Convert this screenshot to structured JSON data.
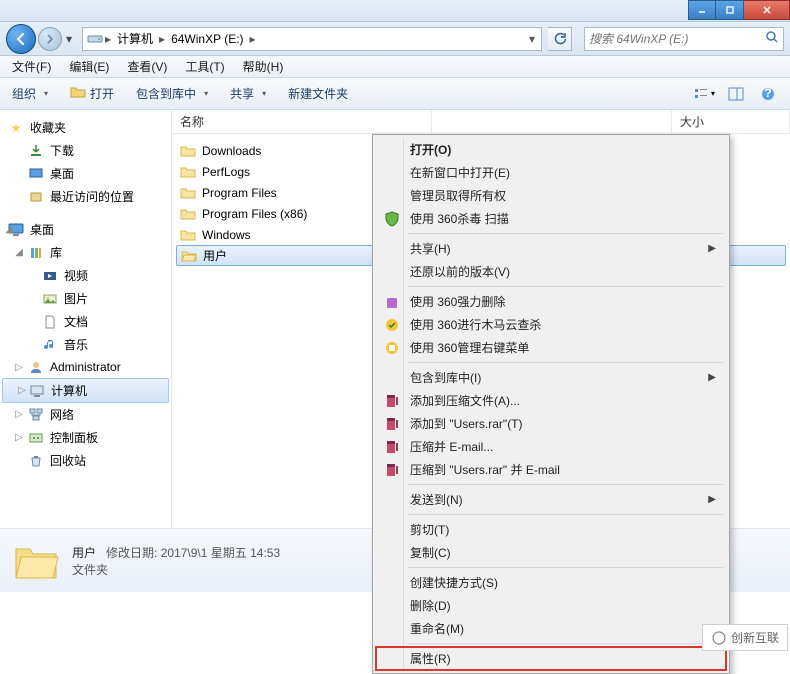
{
  "window": {
    "title_blank": ""
  },
  "address": {
    "root_icon": "computer-icon",
    "segs": [
      "计算机",
      "64WinXP (E:)"
    ],
    "refresh_icon": "refresh-icon"
  },
  "search": {
    "placeholder": "搜索 64WinXP (E:)"
  },
  "menubar": [
    "文件(F)",
    "编辑(E)",
    "查看(V)",
    "工具(T)",
    "帮助(H)"
  ],
  "toolbar": {
    "organize": "组织",
    "open": "打开",
    "include": "包含到库中",
    "share": "共享",
    "newfolder": "新建文件夹"
  },
  "columns": {
    "name": "名称",
    "size": "大小"
  },
  "sidebar": {
    "favorites": {
      "label": "收藏夹",
      "items": [
        "下载",
        "桌面",
        "最近访问的位置"
      ]
    },
    "desktop": {
      "label": "桌面"
    },
    "libraries": {
      "label": "库",
      "items": [
        "视频",
        "图片",
        "文档",
        "音乐"
      ]
    },
    "admin": "Administrator",
    "computer": "计算机",
    "network": "网络",
    "control": "控制面板",
    "recycle": "回收站"
  },
  "files": [
    "Downloads",
    "PerfLogs",
    "Program Files",
    "Program Files (x86)",
    "Windows",
    "用户"
  ],
  "selected_file": "用户",
  "details": {
    "name": "用户",
    "mod_label": "修改日期:",
    "mod_value": "2017\\9\\1 星期五 14:53",
    "type": "文件夹"
  },
  "ctx": {
    "open": "打开(O)",
    "open_new": "在新窗口中打开(E)",
    "admin_own": "管理员取得所有权",
    "scan_360": "使用 360杀毒 扫描",
    "share": "共享(H)",
    "restore": "还原以前的版本(V)",
    "force_del": "使用 360强力删除",
    "trojan": "使用 360进行木马云查杀",
    "manage_menu": "使用 360管理右键菜单",
    "include_lib": "包含到库中(I)",
    "add_archive": "添加到压缩文件(A)...",
    "add_users_rar": "添加到 \"Users.rar\"(T)",
    "compress_email": "压缩并 E-mail...",
    "compress_users_email": "压缩到 \"Users.rar\" 并 E-mail",
    "send_to": "发送到(N)",
    "cut": "剪切(T)",
    "copy": "复制(C)",
    "shortcut": "创建快捷方式(S)",
    "delete": "删除(D)",
    "rename": "重命名(M)",
    "properties": "属性(R)"
  },
  "watermark": "创新互联"
}
